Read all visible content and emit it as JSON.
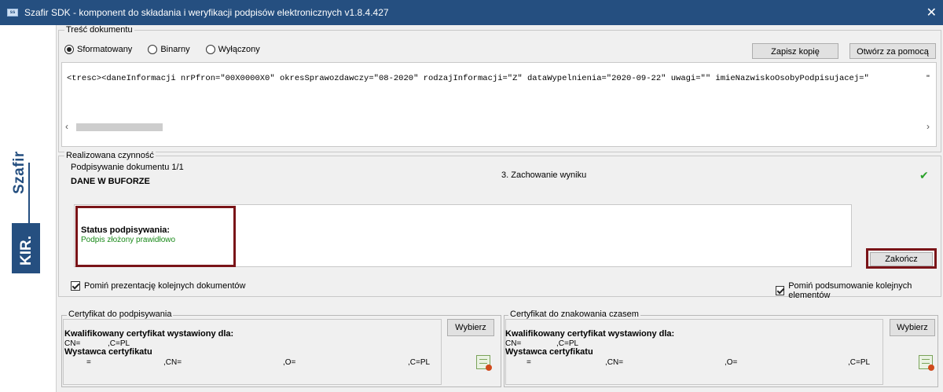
{
  "window": {
    "title": "Szafir SDK - komponent do składania i weryfikacji podpisów elektronicznych v1.8.4.427",
    "close_symbol": "✕"
  },
  "brand": {
    "szafir": "Szafir",
    "kir": "KIR."
  },
  "document": {
    "group_label": "Treść dokumentu",
    "modes": [
      {
        "label": "Sformatowany",
        "selected": true
      },
      {
        "label": "Binarny",
        "selected": false
      },
      {
        "label": "Wyłączony",
        "selected": false
      }
    ],
    "save_copy_label": "Zapisz kopię",
    "open_with_label": "Otwórz za pomocą",
    "xml_content": "<tresc><daneInformacji nrPfron=\"00X0000X0\" okresSprawozdawczy=\"08-2020\" rodzajInformacji=\"Z\" dataWypelnienia=\"2020-09-22\" uwagi=\"\" imieNazwiskoOsobyPodpisujacej=\"",
    "xml_tail": "\""
  },
  "activity": {
    "group_label": "Realizowana czynność",
    "signing_progress": "Podpisywanie dokumentu 1/1",
    "buffer_label": "DANE W BUFORZE",
    "step_label": "3. Zachowanie wyniku",
    "check_symbol": "✔",
    "status_title": "Status podpisywania:",
    "status_value": "Podpis złożony prawidłowo",
    "status_color": "#1a8a1a",
    "finish_label": "Zakończ",
    "skip_presentation_label": "Pomiń prezentację kolejnych dokumentów",
    "skip_summary_label": "Pomiń podsumowanie kolejnych elementów"
  },
  "certificates": {
    "signing": {
      "group_label": "Certyfikat do podpisywania",
      "choose_label": "Wybierz",
      "qualified_label": "Kwalifikowany certyfikat wystawiony dla:",
      "cn_label": "CN=",
      "c_label": ",C=PL",
      "issuer_label": "Wystawca certyfikatu",
      "issuer_eq": "=",
      "issuer_cn": ",CN=",
      "issuer_o": ",O=",
      "issuer_c": ",C=PL"
    },
    "timestamp": {
      "group_label": "Certyfikat do znakowania czasem",
      "choose_label": "Wybierz",
      "qualified_label": "Kwalifikowany certyfikat wystawiony dla:",
      "cn_label": "CN=",
      "c_label": ",C=PL",
      "issuer_label": "Wystawca certyfikatu",
      "issuer_eq": "=",
      "issuer_cn": ",CN=",
      "issuer_o": ",O=",
      "issuer_c": ",C=PL"
    }
  },
  "colors": {
    "title_bar": "#254f80",
    "highlight": "#7a1418",
    "check_green": "#2aa12a"
  }
}
